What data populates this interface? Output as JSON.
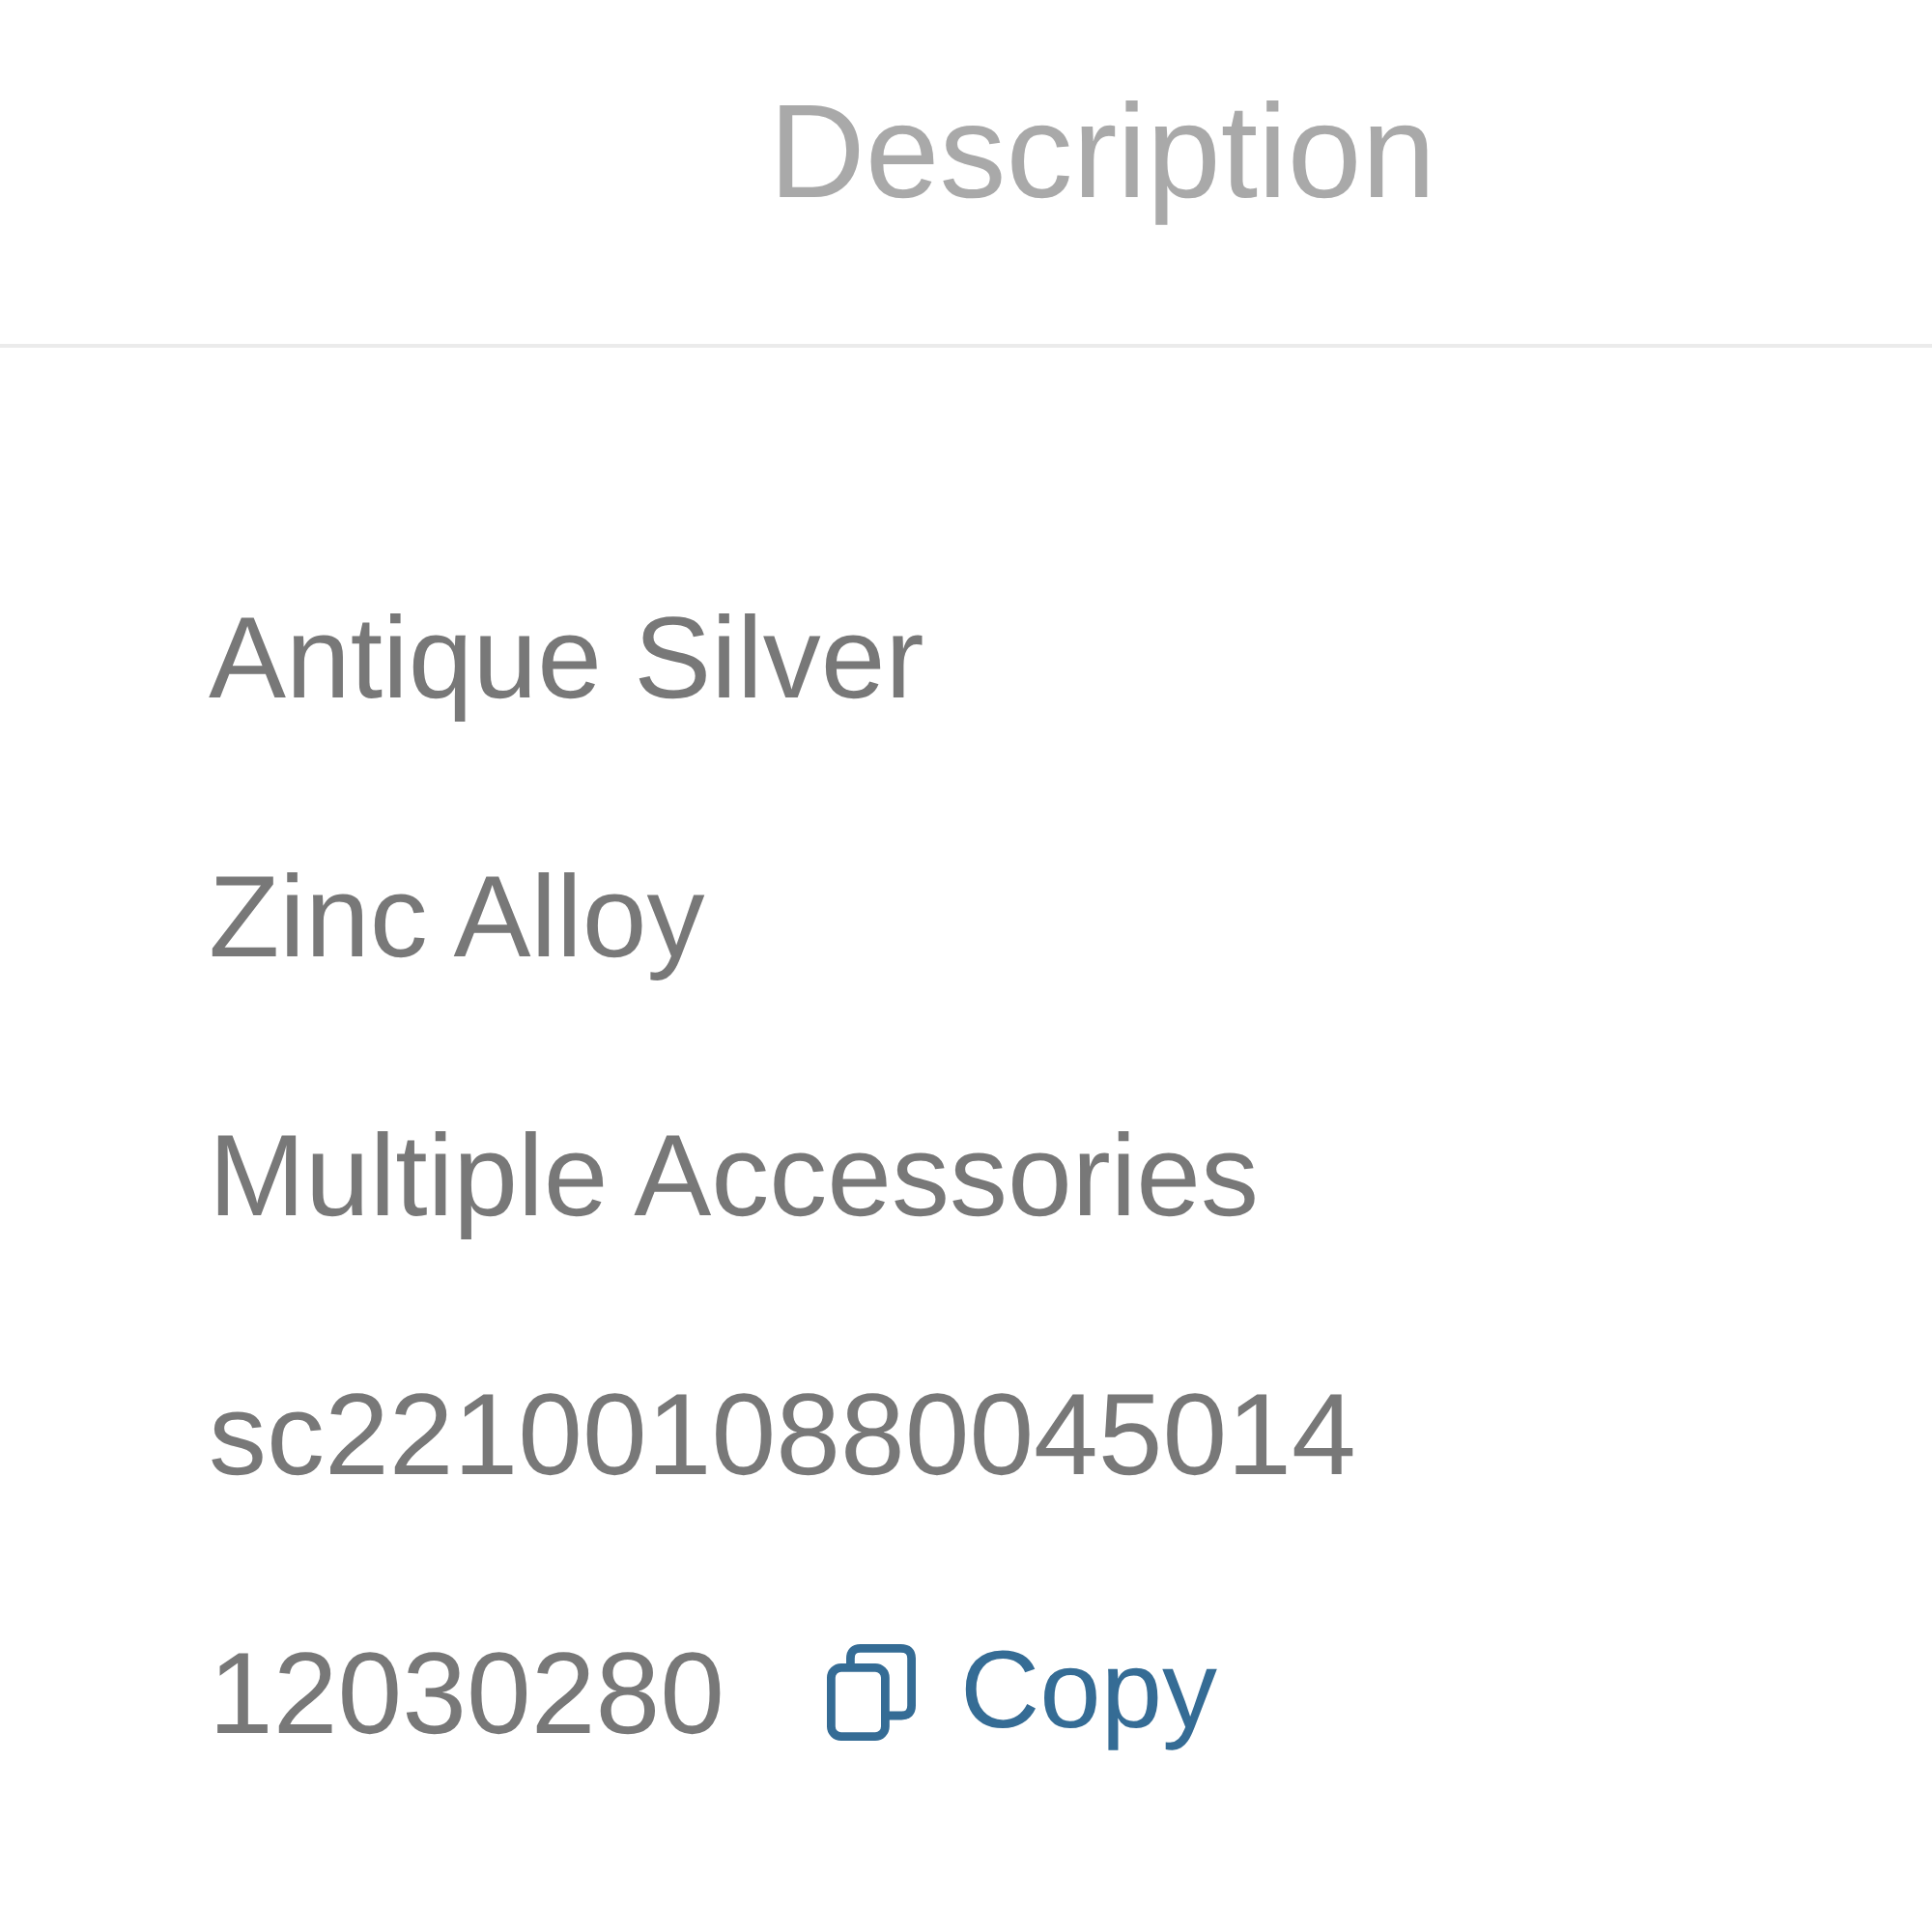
{
  "header": {
    "title": "Description"
  },
  "rows": [
    {
      "value": "Antique Silver"
    },
    {
      "value": "Zinc Alloy"
    },
    {
      "value": "Multiple Accessories"
    },
    {
      "value": "sc2210010880045014"
    },
    {
      "value": "12030280",
      "copy": {
        "label": "Copy"
      }
    }
  ]
}
